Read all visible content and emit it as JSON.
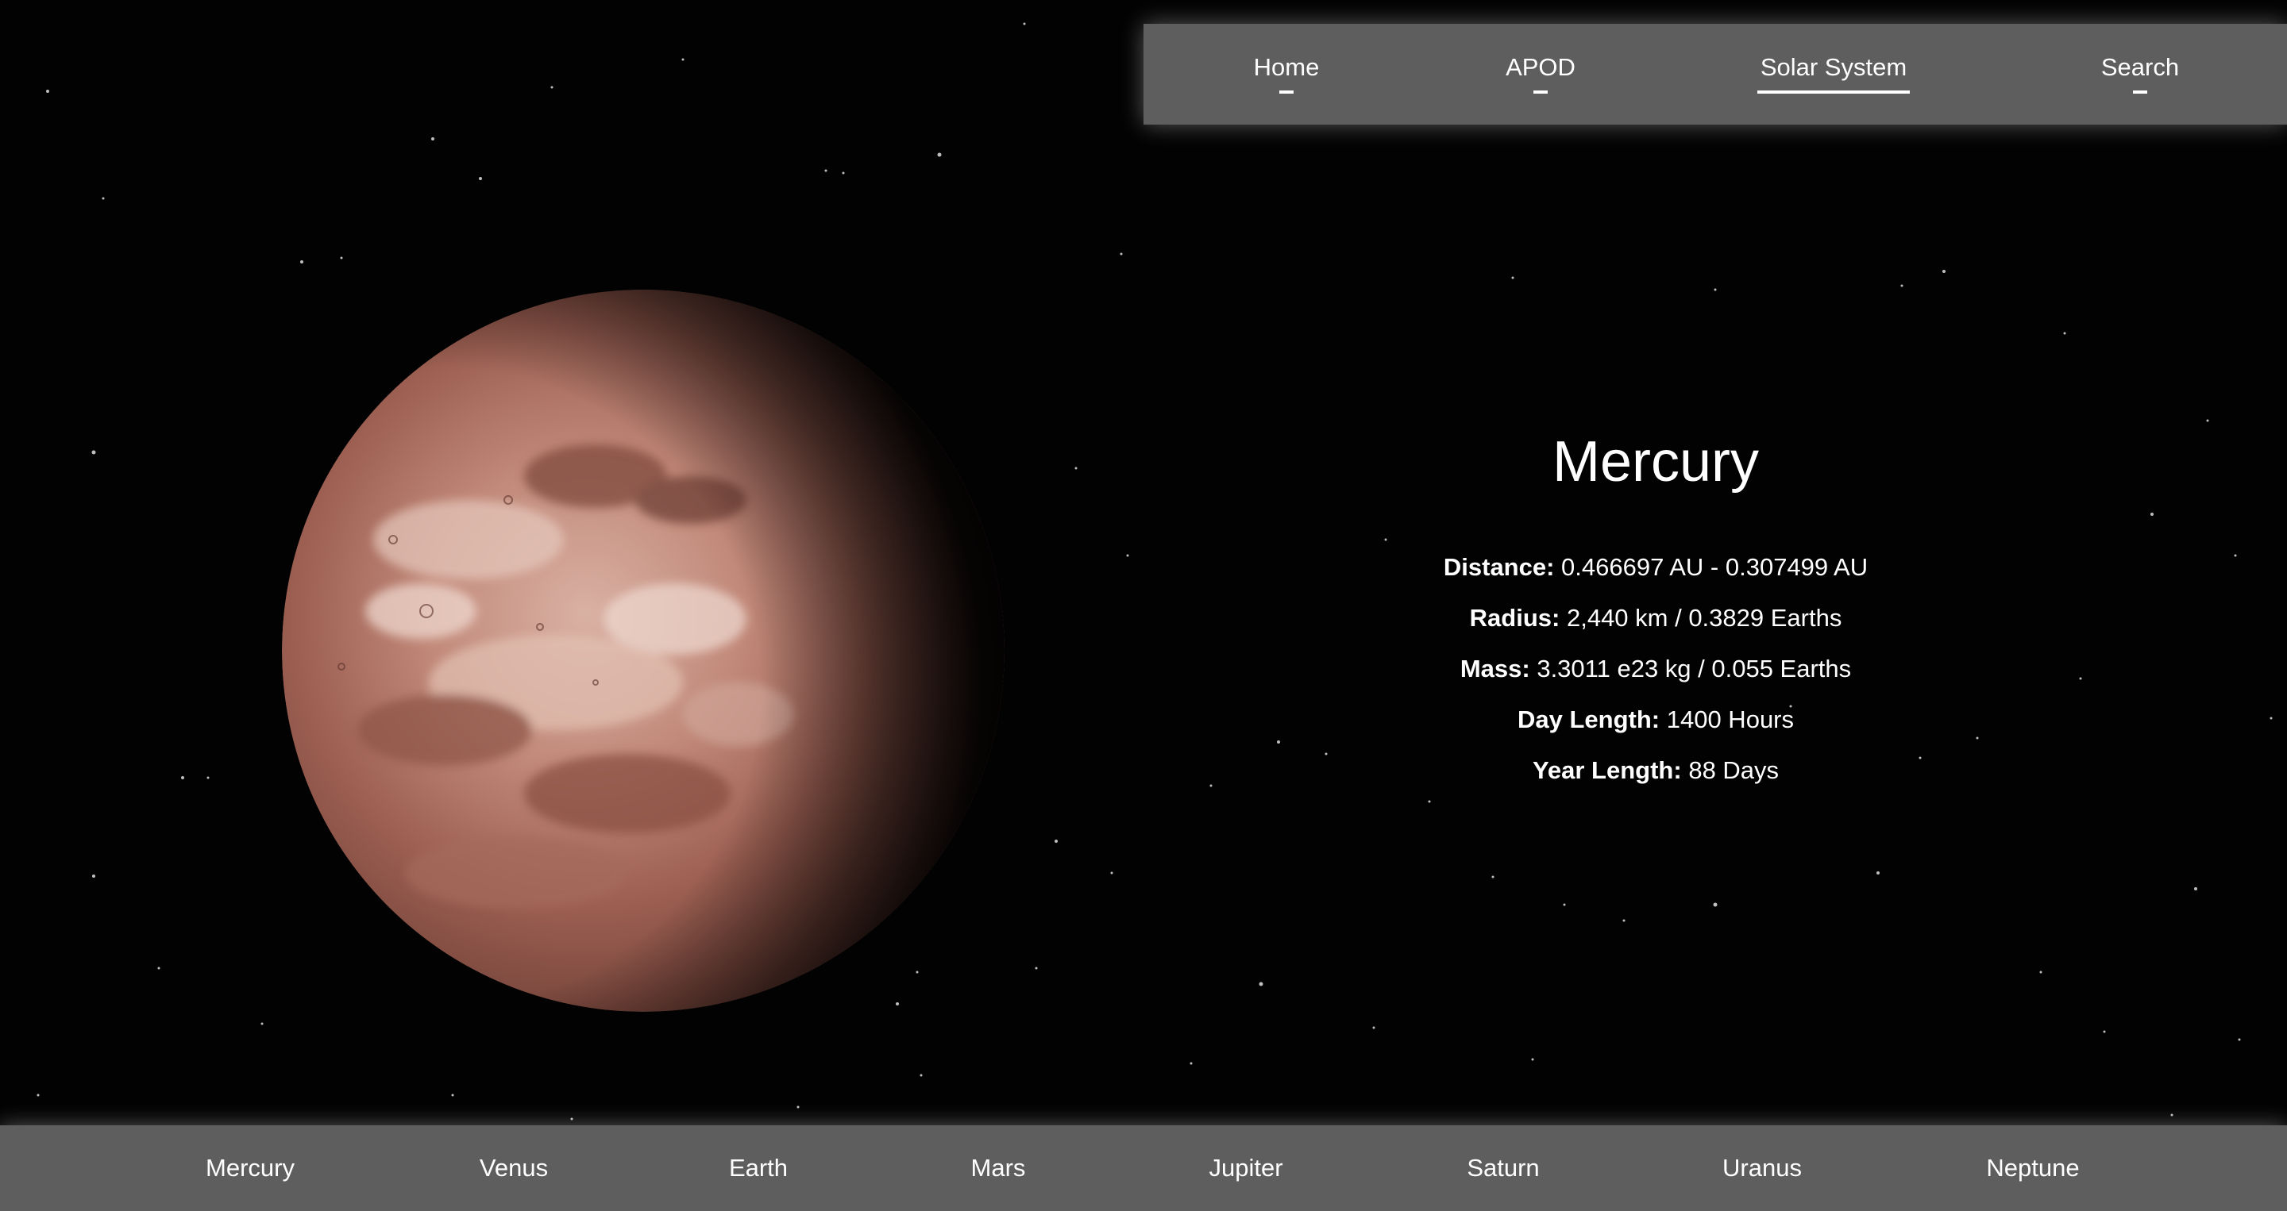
{
  "nav": {
    "items": [
      {
        "label": "Home",
        "active": false
      },
      {
        "label": "APOD",
        "active": false
      },
      {
        "label": "Solar System",
        "active": true
      },
      {
        "label": "Search",
        "active": false
      }
    ]
  },
  "planet": {
    "name": "Mercury",
    "stats": [
      {
        "label": "Distance:",
        "value": "0.466697 AU - 0.307499 AU"
      },
      {
        "label": "Radius:",
        "value": "2,440 km / 0.3829 Earths"
      },
      {
        "label": "Mass:",
        "value": "3.3011 e23 kg / 0.055 Earths"
      },
      {
        "label": "Day Length:",
        "value": "1400 Hours"
      },
      {
        "label": "Year Length:",
        "value": "88 Days"
      }
    ]
  },
  "planet_bar": {
    "items": [
      {
        "label": "Mercury"
      },
      {
        "label": "Venus"
      },
      {
        "label": "Earth"
      },
      {
        "label": "Mars"
      },
      {
        "label": "Jupiter"
      },
      {
        "label": "Saturn"
      },
      {
        "label": "Uranus"
      },
      {
        "label": "Neptune"
      }
    ]
  },
  "colors": {
    "background": "#020202",
    "bar": "#5e5e5e",
    "text": "#ffffff",
    "planet_surface": "#b27a6b"
  }
}
